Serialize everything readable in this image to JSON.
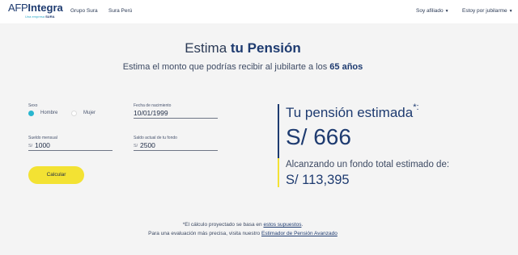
{
  "header": {
    "logo_afp": "AFP",
    "logo_integra": "Integra",
    "logo_tagline_prefix": "Una empresa",
    "logo_tagline_brand": "SURA",
    "nav": {
      "grupo_sura": "Grupo Sura",
      "sura_peru": "Sura Perú",
      "soy_afiliado": "Soy afiliado",
      "estoy_por_jubilarme": "Estoy por jubilarme"
    }
  },
  "hero": {
    "title_plain": "Estima ",
    "title_bold": "tu Pensión",
    "subtitle_plain": "Estima el monto que podrías recibir al jubilarte a los ",
    "subtitle_bold": "65 años"
  },
  "form": {
    "sexo_label": "Sexo",
    "sexo_options": [
      "Hombre",
      "Mujer"
    ],
    "sexo_selected": "Hombre",
    "fecha_label": "Fecha de nacimiento",
    "fecha_value": "10/01/1999",
    "sueldo_label": "Sueldo mensual",
    "sueldo_prefix": "S/",
    "sueldo_value": "1000",
    "saldo_label": "Saldo actual de tu fondo",
    "saldo_prefix": "S/",
    "saldo_value": "2500",
    "calcular_label": "Calcular"
  },
  "result": {
    "title": "Tu pensión estimada",
    "title_mark": "*:",
    "pension_value": "S/ 666",
    "fund_label": "Alcanzando un fondo total estimado de:",
    "fund_value": "S/ 113,395"
  },
  "notes": {
    "line1_text": "*El cálculo proyectado se basa en ",
    "line1_link": "estos supuestos",
    "line1_end": ".",
    "line2_text": "Para una evaluación más precisa, visita nuestro ",
    "line2_link": "Estimador de Pensión Avanzado"
  },
  "colors": {
    "brand_navy": "#1e3b70",
    "accent_yellow": "#f3e233",
    "accent_teal": "#29b6cf"
  }
}
